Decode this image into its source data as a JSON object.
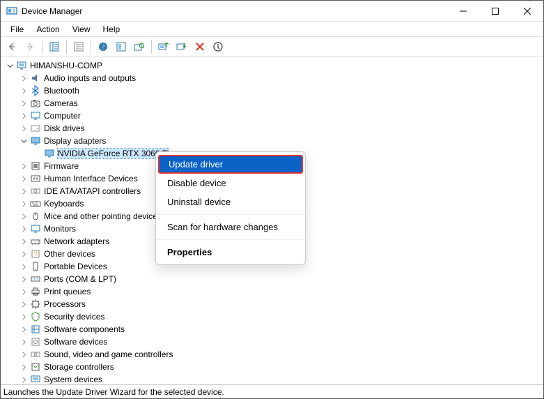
{
  "window": {
    "title": "Device Manager"
  },
  "menu": {
    "file": "File",
    "action": "Action",
    "view": "View",
    "help": "Help"
  },
  "tree": {
    "root": "HIMANSHU-COMP",
    "items": [
      "Audio inputs and outputs",
      "Bluetooth",
      "Cameras",
      "Computer",
      "Disk drives",
      "Display adapters",
      "Firmware",
      "Human Interface Devices",
      "IDE ATA/ATAPI controllers",
      "Keyboards",
      "Mice and other pointing devices",
      "Monitors",
      "Network adapters",
      "Other devices",
      "Portable Devices",
      "Ports (COM & LPT)",
      "Print queues",
      "Processors",
      "Security devices",
      "Software components",
      "Software devices",
      "Sound, video and game controllers",
      "Storage controllers",
      "System devices"
    ],
    "display_child": "NVIDIA GeForce RTX 3060 Ti"
  },
  "context_menu": {
    "update": "Update driver",
    "disable": "Disable device",
    "uninstall": "Uninstall device",
    "scan": "Scan for hardware changes",
    "properties": "Properties"
  },
  "status": "Launches the Update Driver Wizard for the selected device."
}
